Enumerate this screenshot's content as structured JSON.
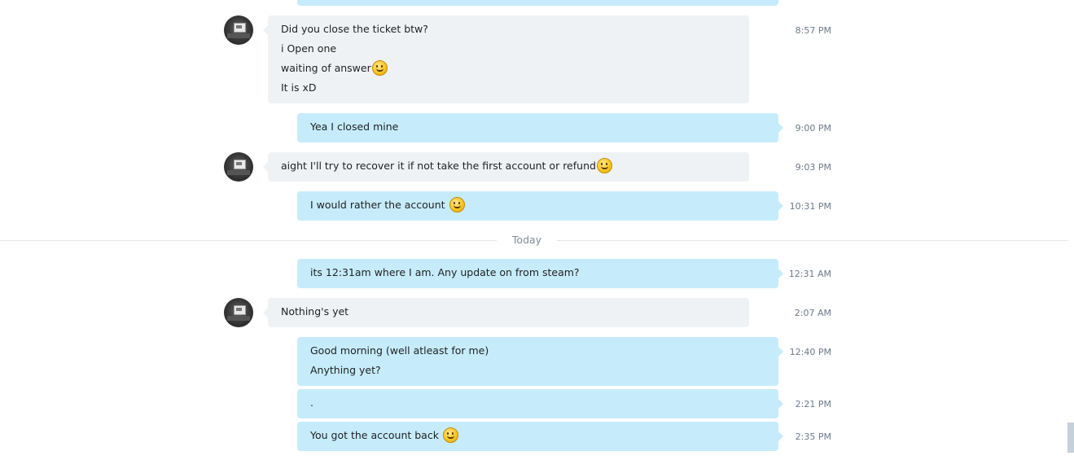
{
  "conversation": {
    "messages": [
      {
        "direction": "in",
        "lines": [
          {
            "text": "Did you close the ticket btw?"
          },
          {
            "text": "i Open one"
          },
          {
            "text": "waiting of answer",
            "emoji": "smile-emoji"
          },
          {
            "text": "It is xD"
          }
        ],
        "time": "8:57 PM"
      },
      {
        "direction": "out",
        "lines": [
          {
            "text": "Yea I closed mine"
          }
        ],
        "time": "9:00 PM"
      },
      {
        "direction": "in",
        "lines": [
          {
            "text": "aight I'll try to recover it if not take the first account or refund",
            "emoji": "smile-emoji"
          }
        ],
        "time": "9:03 PM"
      },
      {
        "direction": "out",
        "lines": [
          {
            "text": "I would rather the account ",
            "emoji": "smile-emoji"
          }
        ],
        "time": "10:31 PM"
      },
      {
        "direction": "out",
        "lines": [
          {
            "text": "its 12:31am where I am. Any update on from steam?"
          }
        ],
        "time": "12:31 AM"
      },
      {
        "direction": "in",
        "lines": [
          {
            "text": "Nothing's yet"
          }
        ],
        "time": "2:07 AM"
      },
      {
        "direction": "out",
        "lines": [
          {
            "text": "Good morning (well atleast for me)"
          },
          {
            "text": "Anything yet?"
          }
        ],
        "time": "12:40 PM"
      },
      {
        "direction": "out",
        "lines": [
          {
            "text": "."
          }
        ],
        "time": "2:21 PM"
      },
      {
        "direction": "out",
        "lines": [
          {
            "text": "You got the account back ",
            "emoji": "smile-emoji"
          }
        ],
        "time": "2:35 PM"
      }
    ],
    "divider_label": "Today",
    "avatar_icon": "contact-avatar-icon",
    "colors": {
      "incoming_bubble": "#eff2f5",
      "outgoing_bubble": "#c6ecfb",
      "timestamp": "#6b7a89"
    }
  }
}
